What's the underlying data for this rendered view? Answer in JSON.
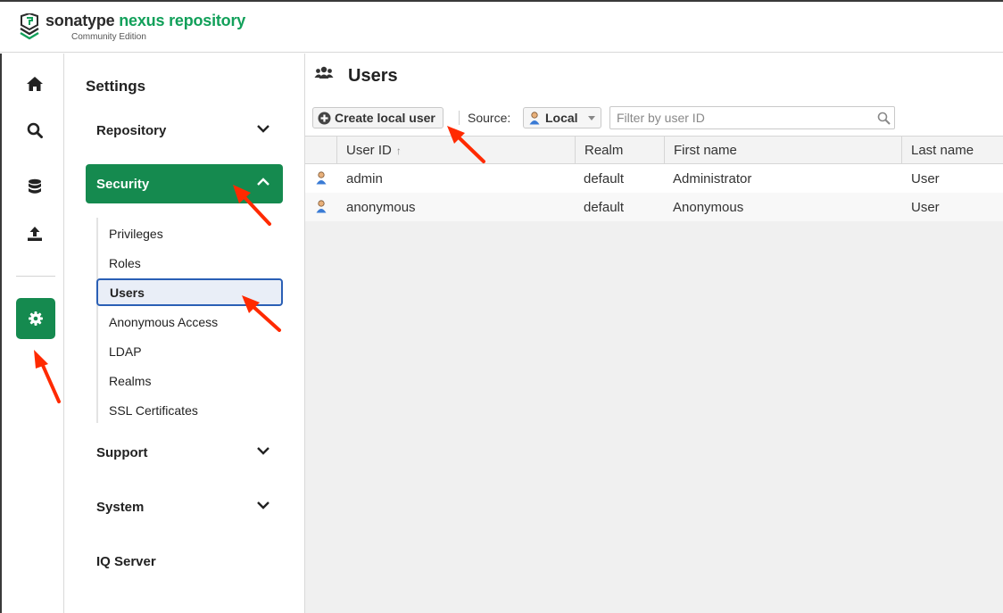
{
  "header": {
    "brand_primary": "sonatype",
    "brand_secondary": "nexus repository",
    "edition": "Community Edition"
  },
  "rail": {
    "items": [
      {
        "icon": "home-icon"
      },
      {
        "icon": "search-icon"
      },
      {
        "icon": "database-icon"
      },
      {
        "icon": "upload-icon"
      },
      {
        "icon": "gear-icon",
        "active": true
      }
    ]
  },
  "nav": {
    "title": "Settings",
    "sections": {
      "repository": "Repository",
      "security": "Security",
      "support": "Support",
      "system": "System",
      "iq_server": "IQ Server"
    },
    "security_items": [
      "Privileges",
      "Roles",
      "Users",
      "Anonymous Access",
      "LDAP",
      "Realms",
      "SSL Certificates"
    ],
    "selected": "Users"
  },
  "main": {
    "title": "Users",
    "toolbar": {
      "create_label": "Create local user",
      "source_label": "Source:",
      "source_value": "Local",
      "filter_placeholder": "Filter by user ID"
    },
    "columns": [
      "User ID",
      "Realm",
      "First name",
      "Last name"
    ],
    "rows": [
      {
        "user_id": "admin",
        "realm": "default",
        "first_name": "Administrator",
        "last_name": "User"
      },
      {
        "user_id": "anonymous",
        "realm": "default",
        "first_name": "Anonymous",
        "last_name": "User"
      }
    ]
  },
  "colors": {
    "accent_green": "#158a4f",
    "selection_blue": "#2a5fb5",
    "annotation_red": "#ff2a00"
  }
}
